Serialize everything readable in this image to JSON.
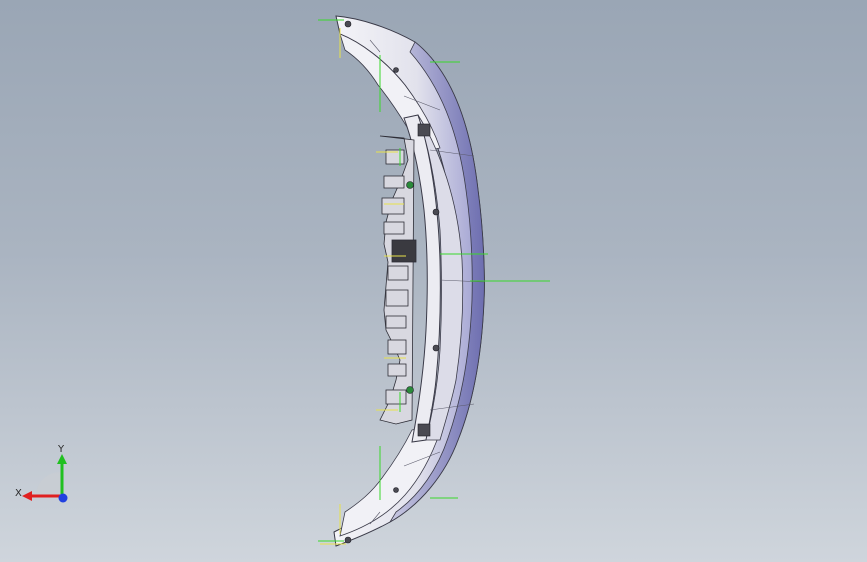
{
  "viewport": {
    "background_top": "#9aa6b5",
    "background_bottom": "#cfd5dc"
  },
  "model": {
    "part_description_icon": "front-bumper-model",
    "reference_line_color": "#39d82a",
    "sketch_line_color": "#e8e24a",
    "edge_color": "#3a3a48",
    "surface_color": "#e9e9f2",
    "shade_color": "#8d8ec6"
  },
  "triad": {
    "x_label": "X",
    "y_label": "Y",
    "x_color": "#e02020",
    "y_color": "#20c020",
    "z_color": "#2040e0"
  }
}
